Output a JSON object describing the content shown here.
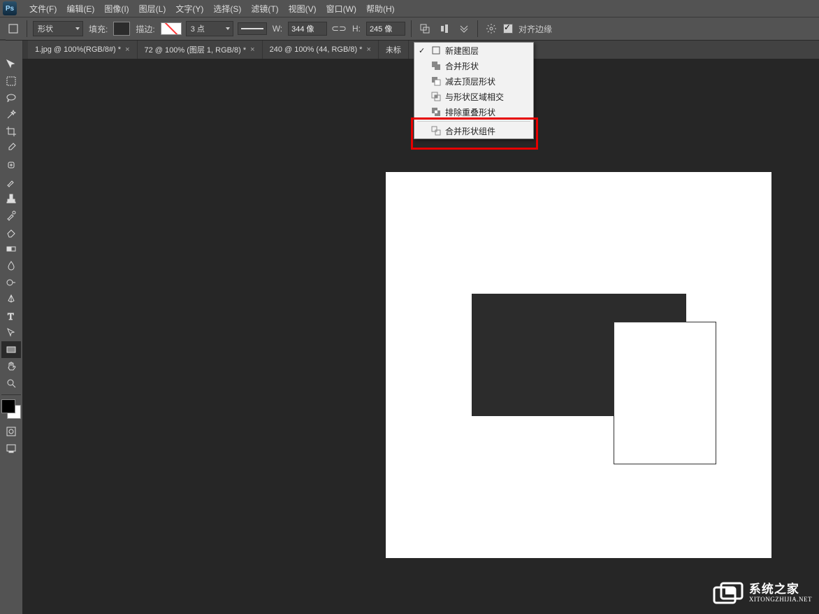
{
  "menubar": {
    "items": [
      "文件(F)",
      "编辑(E)",
      "图像(I)",
      "图层(L)",
      "文字(Y)",
      "选择(S)",
      "滤镜(T)",
      "视图(V)",
      "窗口(W)",
      "帮助(H)"
    ]
  },
  "optbar": {
    "shape_mode": "形状",
    "fill_label": "填充:",
    "stroke_label": "描边:",
    "stroke_pt": "3 点",
    "w_label": "W:",
    "w_value": "344 像",
    "h_label": "H:",
    "h_value": "245 像",
    "align_label": "对齐边缘"
  },
  "tabs": [
    {
      "label": "1.jpg @ 100%(RGB/8#) *"
    },
    {
      "label": "72 @ 100% (图层 1, RGB/8) *"
    },
    {
      "label": "240 @ 100% (44, RGB/8) *"
    },
    {
      "label": "未标"
    }
  ],
  "popup": {
    "items": [
      {
        "label": "新建图层",
        "checked": true
      },
      {
        "label": "合并形状"
      },
      {
        "label": "减去顶层形状"
      },
      {
        "label": "与形状区域相交"
      },
      {
        "label": "排除重叠形状"
      },
      {
        "label": "合并形状组件",
        "sep_before": true
      }
    ]
  },
  "watermark": {
    "title": "系统之家",
    "url": "XITONGZHIJIA.NET"
  }
}
